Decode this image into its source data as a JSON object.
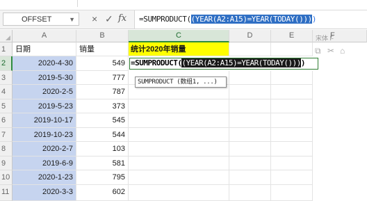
{
  "formula_bar": {
    "name_box": "OFFSET",
    "cancel_icon": "×",
    "enter_icon": "✓",
    "fx_label": "fx",
    "formula_prefix": "=SUMPRODUCT(",
    "formula_highlight": "(YEAR(A2:A15)=YEAR(TODAY()))",
    "formula_suffix": ")"
  },
  "columns": [
    "A",
    "B",
    "C",
    "D",
    "E",
    "F"
  ],
  "rows": [
    "1",
    "2",
    "3",
    "4",
    "5",
    "6",
    "7",
    "8",
    "9",
    "10",
    "11"
  ],
  "header_row": {
    "a": "日期",
    "b": "销量",
    "c": "统计2020年销量"
  },
  "data_rows": [
    {
      "date": "2020-4-30",
      "sales": "549"
    },
    {
      "date": "2019-5-30",
      "sales": "777"
    },
    {
      "date": "2020-2-5",
      "sales": "787"
    },
    {
      "date": "2019-5-23",
      "sales": "373"
    },
    {
      "date": "2019-10-17",
      "sales": "545"
    },
    {
      "date": "2019-10-23",
      "sales": "544"
    },
    {
      "date": "2020-2-7",
      "sales": "103"
    },
    {
      "date": "2019-6-9",
      "sales": "581"
    },
    {
      "date": "2020-1-23",
      "sales": "795"
    },
    {
      "date": "2020-3-3",
      "sales": "602"
    }
  ],
  "edit_cell": {
    "prefix": "=SUMPRODUCT(",
    "highlight": "(YEAR(A2:A15)=YEAR(TODAY()))",
    "suffix": ")"
  },
  "tooltip": "SUMPRODUCT (数组1, ...)",
  "right_panel": {
    "label": "宋体 F"
  },
  "colors": {
    "selection": "#c6d4ef",
    "highlight_bg": "#2f6fc4",
    "active_green": "#2e8b3e",
    "header_yellow": "#ffff00"
  }
}
